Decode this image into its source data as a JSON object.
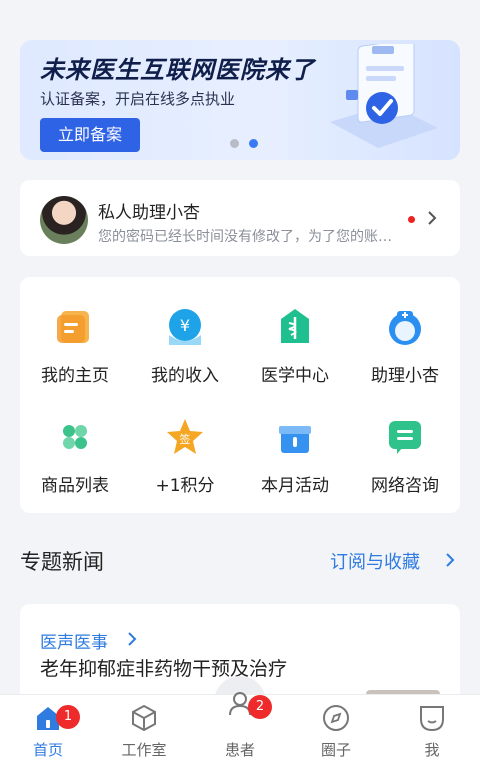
{
  "banner": {
    "title": "未来医生互联网医院来了",
    "subtitle": "认证备案，开启在线多点执业",
    "button": "立即备案"
  },
  "assistant": {
    "name": "私人助理小杏",
    "message": "您的密码已经长时间没有修改了，为了您的账号安全"
  },
  "grid": [
    {
      "label": "我的主页",
      "icon": "homepage-icon",
      "color": "#f59a2b"
    },
    {
      "label": "我的收入",
      "icon": "income-icon",
      "color": "#1fa3e8"
    },
    {
      "label": "医学中心",
      "icon": "medical-center-icon",
      "color": "#1fbf8f"
    },
    {
      "label": "助理小杏",
      "icon": "nurse-icon",
      "color": "#2a8ff0"
    },
    {
      "label": "商品列表",
      "icon": "clover-icon",
      "color": "#3cc28a"
    },
    {
      "label": "+1积分",
      "icon": "sign-star-icon",
      "color": "#f5a623"
    },
    {
      "label": "本月活动",
      "icon": "gift-icon",
      "color": "#3592f0"
    },
    {
      "label": "网络咨询",
      "icon": "chat-icon",
      "color": "#2fc28a"
    }
  ],
  "section": {
    "title": "专题新闻",
    "link": "订阅与收藏"
  },
  "news": {
    "tag": "医声医事",
    "title": "老年抑郁症非药物干预及治疗"
  },
  "tabs": [
    {
      "label": "首页",
      "icon": "home-icon",
      "badge": "1"
    },
    {
      "label": "工作室",
      "icon": "cube-icon",
      "badge": ""
    },
    {
      "label": "患者",
      "icon": "patient-icon",
      "badge": "2"
    },
    {
      "label": "圈子",
      "icon": "compass-icon",
      "badge": ""
    },
    {
      "label": "我",
      "icon": "face-icon",
      "badge": ""
    }
  ],
  "colors": {
    "accent": "#2f7be0",
    "badge": "#ee2a2a",
    "banner_button": "#2f63e6"
  }
}
